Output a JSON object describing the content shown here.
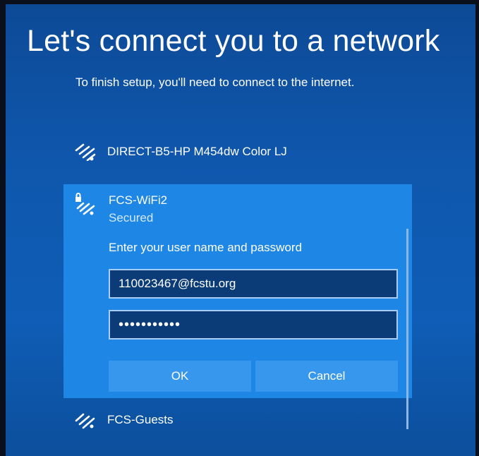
{
  "page": {
    "title": "Let's connect you to a network",
    "subtitle": "To finish setup, you'll need to connect to the internet."
  },
  "networks": [
    {
      "name": "DIRECT-B5-HP M454dw Color LJ",
      "icon": "wifi-signal-icon"
    },
    {
      "name": "FCS-WiFi2",
      "status": "Secured",
      "icon": "wifi-secured-icon",
      "expanded": true,
      "prompt": "Enter your user name and password",
      "username_value": "110023467@fcstu.org",
      "password_value": "•••••••••••",
      "ok_label": "OK",
      "cancel_label": "Cancel"
    },
    {
      "name": "FCS-Guests",
      "icon": "wifi-signal-icon"
    }
  ],
  "colors": {
    "background": "#0f57ad",
    "panel": "#1e86e4",
    "field": "#0c3c78",
    "button": "#3797ec"
  }
}
